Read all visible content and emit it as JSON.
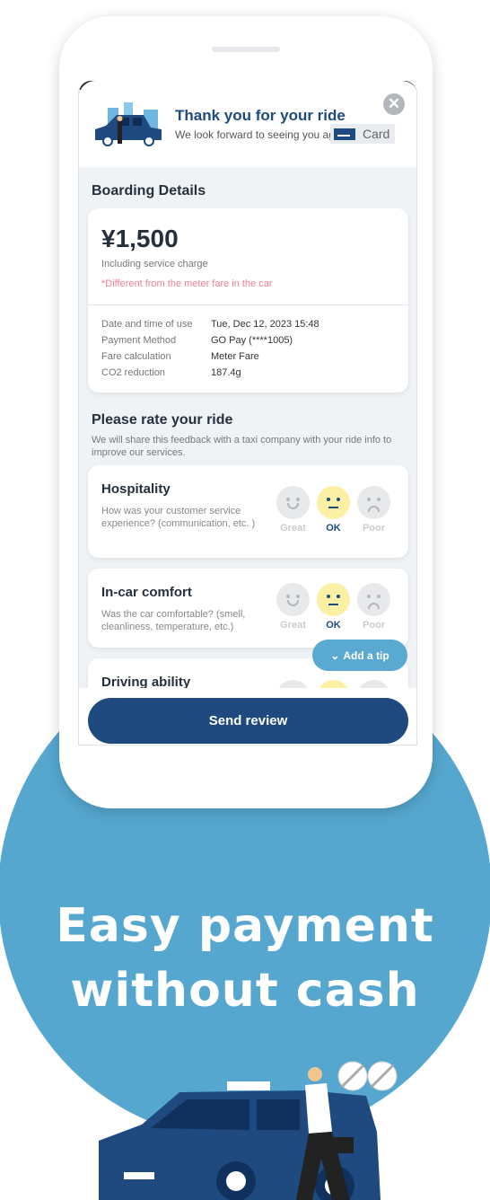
{
  "header": {
    "title": "Thank you for your ride",
    "subtitle": "We look forward to seeing you again",
    "card_label": "Card",
    "close_icon": "close-icon"
  },
  "boarding": {
    "title": "Boarding Details",
    "price": "¥1,500",
    "including": "Including service charge",
    "note": "*Different from the meter fare in the car",
    "rows": [
      {
        "k": "Date and time of use",
        "v": "Tue, Dec 12, 2023 15:48"
      },
      {
        "k": "Payment Method",
        "v": "GO Pay (****1005)"
      },
      {
        "k": "Fare calculation",
        "v": "Meter Fare"
      },
      {
        "k": "CO2 reduction",
        "v": "187.4g"
      }
    ]
  },
  "rating": {
    "title": "Please rate your ride",
    "subtitle": "We will share this feedback with a taxi company with your ride info to improve our services.",
    "options": [
      "Great",
      "OK",
      "Poor"
    ],
    "items": [
      {
        "title": "Hospitality",
        "desc": "How was your customer service experience? (communication, etc. )",
        "selected": "OK"
      },
      {
        "title": "In-car comfort",
        "desc": "Was the car comfortable? (smell, cleanliness, temperature, etc.)",
        "selected": "OK"
      },
      {
        "title": "Driving ability",
        "desc": "",
        "selected": "OK"
      }
    ]
  },
  "tip_label": "Add a tip",
  "send_label": "Send review",
  "promo": {
    "line1": "Easy payment",
    "line2": "without cash"
  },
  "colors": {
    "brand": "#1f4a7f",
    "accent": "#56a7d0",
    "selected_face": "#fbf0a3",
    "note": "#f07f93"
  }
}
